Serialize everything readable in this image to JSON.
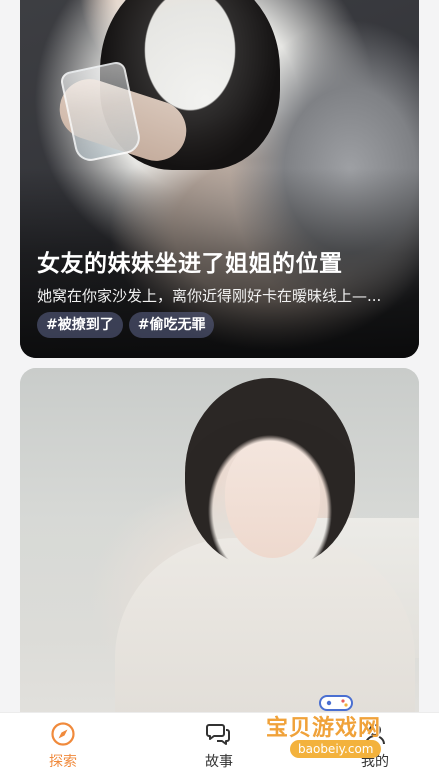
{
  "feed": {
    "cards": [
      {
        "title": "女友的妹妹坐进了姐姐的位置",
        "description": "她窝在你家沙发上，离你近得刚好卡在暧昧线上—...",
        "tags": [
          "#被撩到了",
          "#偷吃无罪"
        ]
      },
      {
        "title": "",
        "description": "",
        "tags": []
      }
    ]
  },
  "bottom_nav": {
    "items": [
      {
        "label": "探索",
        "icon": "compass-icon",
        "color": "#f08a3c"
      },
      {
        "label": "故事",
        "icon": "chat-bubbles-icon",
        "color": "#333333"
      },
      {
        "label": "我的",
        "icon": "person-icon",
        "color": "#333333"
      }
    ]
  },
  "watermark": {
    "text": "宝贝游戏网",
    "url": "baobeiy.com"
  },
  "colors": {
    "accent": "#f08a3c",
    "tag_bg": "#5f668c",
    "page_bg": "#f4f4f5"
  }
}
